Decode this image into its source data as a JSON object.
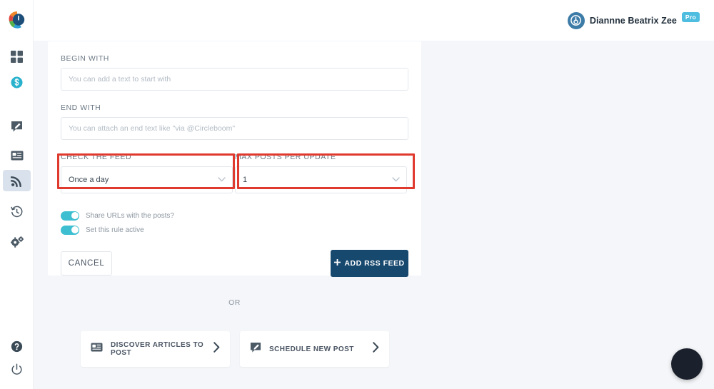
{
  "brand": {
    "logo_icon": "circleboom-logo-icon",
    "accent_navy": "#17486e",
    "accent_teal": "#3dbfd1",
    "highlight_red": "#e03a2f",
    "page_background": "#f4f6f9"
  },
  "header": {
    "user_name": "Diannne Beatrix Zee",
    "plan_badge": "Pro",
    "avatar_icon": "user-avatar-icon"
  },
  "sidebar": {
    "items": [
      {
        "name": "dashboard",
        "icon": "grid-dashboard-icon",
        "active": false
      },
      {
        "name": "credits",
        "icon": "coin-dollar-icon",
        "active": false
      },
      {
        "name": "compose",
        "icon": "pencil-edit-icon",
        "active": false
      },
      {
        "name": "queue",
        "icon": "newspaper-queue-icon",
        "active": false
      },
      {
        "name": "rss",
        "icon": "rss-feed-icon",
        "active": true
      },
      {
        "name": "history",
        "icon": "history-clock-icon",
        "active": false
      },
      {
        "name": "settings",
        "icon": "gears-settings-icon",
        "active": false
      },
      {
        "name": "help",
        "icon": "question-help-icon",
        "active": false
      },
      {
        "name": "logout",
        "icon": "power-logout-icon",
        "active": false
      }
    ]
  },
  "form": {
    "begin_with": {
      "label": "BEGIN WITH",
      "value": "",
      "placeholder": "You can add a text to start with"
    },
    "end_with": {
      "label": "END WITH",
      "value": "",
      "placeholder": "You can attach an end text like \"via @Circleboom\""
    },
    "check_the_feed": {
      "label": "CHECK THE FEED",
      "selected": "Once a day",
      "chevron_icon": "chevron-down-icon",
      "highlighted": true
    },
    "max_posts_per_update": {
      "label": "MAX POSTS PER UPDATE",
      "selected": "1",
      "chevron_icon": "chevron-down-icon",
      "highlighted": true
    },
    "toggles": [
      {
        "label": "Share URLs with the posts?",
        "on": true
      },
      {
        "label": "Set this rule active",
        "on": true
      }
    ],
    "cancel_label": "CANCEL",
    "submit_label": "ADD RSS FEED",
    "submit_plus_icon": "plus-icon"
  },
  "divider": {
    "or_label": "OR"
  },
  "quick_actions": [
    {
      "label": "DISCOVER ARTICLES TO POST",
      "icon": "newspaper-articles-icon",
      "chevron_icon": "chevron-right-icon"
    },
    {
      "label": "SCHEDULE NEW POST",
      "icon": "pencil-edit-icon",
      "chevron_icon": "chevron-right-icon"
    }
  ],
  "fab": {
    "icon": "hamburger-menu-icon"
  }
}
